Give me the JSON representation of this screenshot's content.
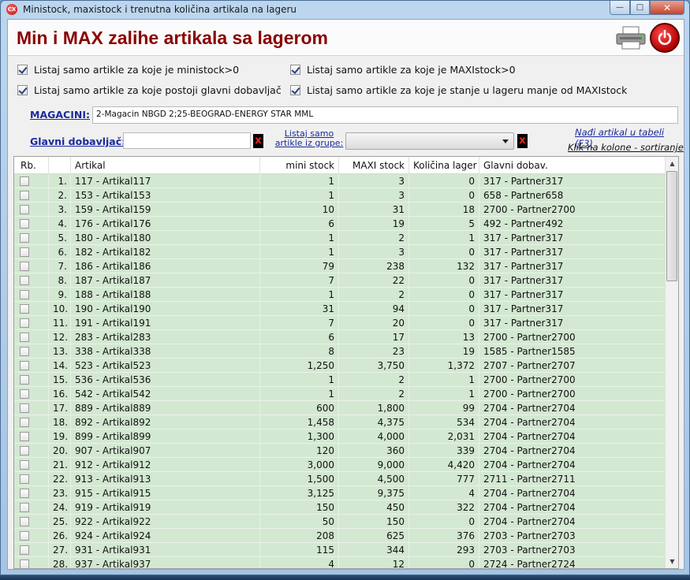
{
  "window": {
    "title": "Ministock, maxistock i trenutna količina artikala na lageru",
    "icon_text": "CX"
  },
  "header": {
    "title": "Min i MAX zalihe artikala sa lagerom"
  },
  "filters": {
    "cb1": {
      "label": "Listaj samo artikle za koje je ministock>0",
      "checked": true
    },
    "cb2": {
      "label": "Listaj samo artikle za koje postoji glavni dobavljač",
      "checked": true
    },
    "cb3": {
      "label": "Listaj samo artikle za koje je MAXIstock>0",
      "checked": true
    },
    "cb4": {
      "label": "Listaj samo artikle za koje je stanje u lageru manje od MAXIstock",
      "checked": true
    }
  },
  "magacini": {
    "label": "MAGACINI:",
    "value": "2-Magacin NBGD 2;25-BEOGRAD-ENERGY STAR MML"
  },
  "dobavljac": {
    "label": "Glavni dobavljač:",
    "value": "",
    "clear": "x"
  },
  "grupe": {
    "label_line1": "Listaj samo",
    "label_line2": "artikle iz grupe:",
    "value": "",
    "clear": "x"
  },
  "links": {
    "find": "Nađi artikal u tabeli (F3)",
    "sort": "Klik na kolone - sortiranje"
  },
  "table": {
    "headers": [
      "Rb.",
      "Artikal",
      "mini stock",
      "MAXI stock",
      "Količina lager",
      "Glavni dobav."
    ],
    "rows": [
      [
        "1.",
        "117 - Artikal117",
        "1",
        "3",
        "0",
        "317 - Partner317"
      ],
      [
        "2.",
        "153 - Artikal153",
        "1",
        "3",
        "0",
        "658 - Partner658"
      ],
      [
        "3.",
        "159 - Artikal159",
        "10",
        "31",
        "18",
        "2700 - Partner2700"
      ],
      [
        "4.",
        "176 - Artikal176",
        "6",
        "19",
        "5",
        "492 - Partner492"
      ],
      [
        "5.",
        "180 - Artikal180",
        "1",
        "2",
        "1",
        "317 - Partner317"
      ],
      [
        "6.",
        "182 - Artikal182",
        "1",
        "3",
        "0",
        "317 - Partner317"
      ],
      [
        "7.",
        "186 - Artikal186",
        "79",
        "238",
        "132",
        "317 - Partner317"
      ],
      [
        "8.",
        "187 - Artikal187",
        "7",
        "22",
        "0",
        "317 - Partner317"
      ],
      [
        "9.",
        "188 - Artikal188",
        "1",
        "2",
        "0",
        "317 - Partner317"
      ],
      [
        "10.",
        "190 - Artikal190",
        "31",
        "94",
        "0",
        "317 - Partner317"
      ],
      [
        "11.",
        "191 - Artikal191",
        "7",
        "20",
        "0",
        "317 - Partner317"
      ],
      [
        "12.",
        "283 - Artikal283",
        "6",
        "17",
        "13",
        "2700 - Partner2700"
      ],
      [
        "13.",
        "338 - Artikal338",
        "8",
        "23",
        "19",
        "1585 - Partner1585"
      ],
      [
        "14.",
        "523 - Artikal523",
        "1,250",
        "3,750",
        "1,372",
        "2707 - Partner2707"
      ],
      [
        "15.",
        "536 - Artikal536",
        "1",
        "2",
        "1",
        "2700 - Partner2700"
      ],
      [
        "16.",
        "542 - Artikal542",
        "1",
        "2",
        "1",
        "2700 - Partner2700"
      ],
      [
        "17.",
        "889 - Artikal889",
        "600",
        "1,800",
        "99",
        "2704 - Partner2704"
      ],
      [
        "18.",
        "892 - Artikal892",
        "1,458",
        "4,375",
        "534",
        "2704 - Partner2704"
      ],
      [
        "19.",
        "899 - Artikal899",
        "1,300",
        "4,000",
        "2,031",
        "2704 - Partner2704"
      ],
      [
        "20.",
        "907 - Artikal907",
        "120",
        "360",
        "339",
        "2704 - Partner2704"
      ],
      [
        "21.",
        "912 - Artikal912",
        "3,000",
        "9,000",
        "4,420",
        "2704 - Partner2704"
      ],
      [
        "22.",
        "913 - Artikal913",
        "1,500",
        "4,500",
        "777",
        "2711 - Partner2711"
      ],
      [
        "23.",
        "915 - Artikal915",
        "3,125",
        "9,375",
        "4",
        "2704 - Partner2704"
      ],
      [
        "24.",
        "919 - Artikal919",
        "150",
        "450",
        "322",
        "2704 - Partner2704"
      ],
      [
        "25.",
        "922 - Artikal922",
        "50",
        "150",
        "0",
        "2704 - Partner2704"
      ],
      [
        "26.",
        "924 - Artikal924",
        "208",
        "625",
        "376",
        "2703 - Partner2703"
      ],
      [
        "27.",
        "931 - Artikal931",
        "115",
        "344",
        "293",
        "2703 - Partner2703"
      ],
      [
        "28.",
        "937 - Artikal937",
        "4",
        "12",
        "0",
        "2724 - Partner2724"
      ]
    ]
  },
  "colors": {
    "row_bg": "#d3e8d1",
    "title_red": "#8a0000",
    "link_blue": "#1a2a9c"
  }
}
